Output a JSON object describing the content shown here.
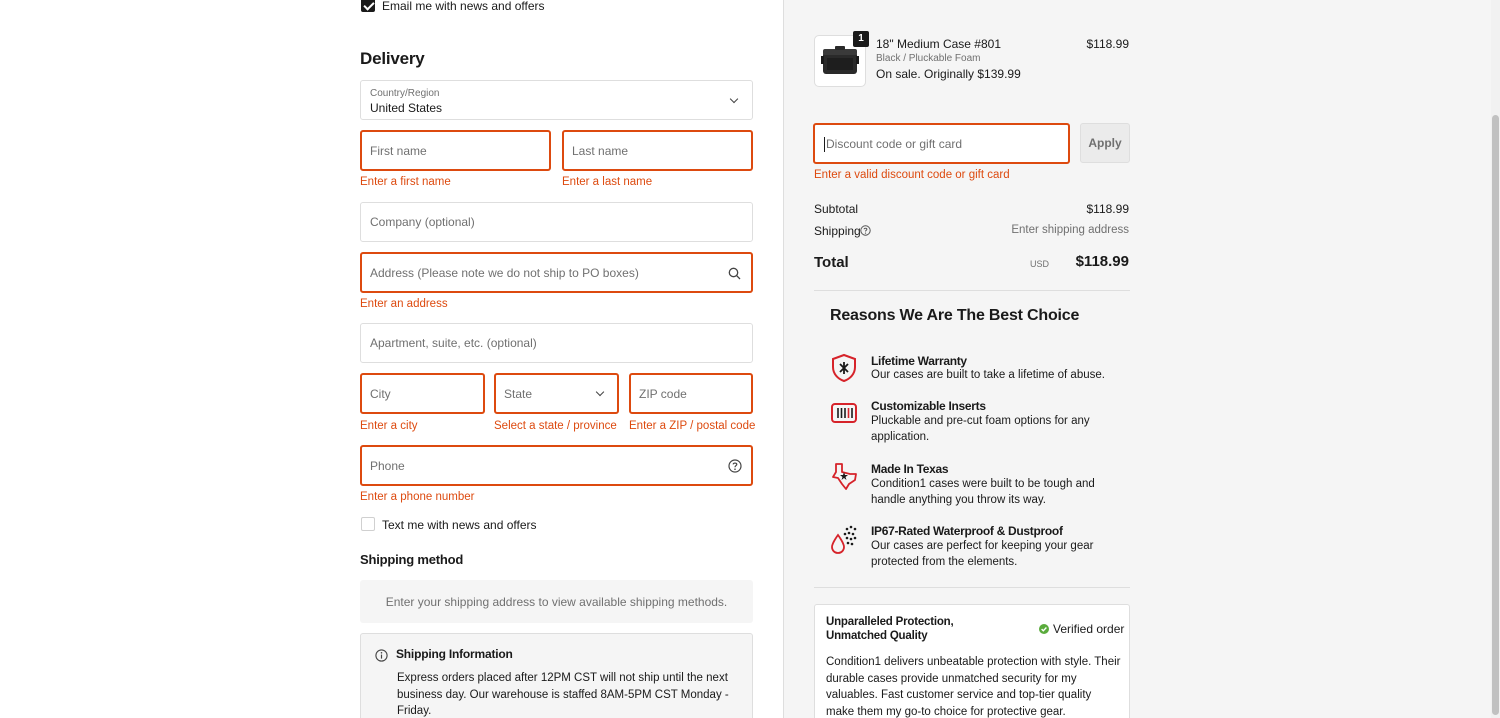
{
  "contact": {
    "email_opt_in_label": "Email me with news and offers",
    "email_opt_in_checked": true
  },
  "delivery": {
    "heading": "Delivery",
    "country": {
      "label": "Country/Region",
      "value": "United States"
    },
    "first_name": {
      "placeholder": "First name",
      "error": "Enter a first name"
    },
    "last_name": {
      "placeholder": "Last name",
      "error": "Enter a last name"
    },
    "company": {
      "placeholder": "Company (optional)"
    },
    "address": {
      "placeholder": "Address (Please note we do not ship to PO boxes)",
      "error": "Enter an address"
    },
    "apartment": {
      "placeholder": "Apartment, suite, etc. (optional)"
    },
    "city": {
      "placeholder": "City",
      "error": "Enter a city"
    },
    "state": {
      "placeholder": "State",
      "error": "Select a state / province"
    },
    "zip": {
      "placeholder": "ZIP code",
      "error": "Enter a ZIP / postal code"
    },
    "phone": {
      "placeholder": "Phone",
      "error": "Enter a phone number"
    },
    "sms_opt_in_label": "Text me with news and offers",
    "sms_opt_in_checked": false
  },
  "shipping_method": {
    "heading": "Shipping method",
    "empty_text": "Enter your shipping address to view available shipping methods."
  },
  "shipping_info": {
    "title": "Shipping Information",
    "lines": [
      "Express orders placed after 12PM CST will not ship until the next",
      "business day. Our warehouse is staffed 8AM-5PM CST Monday -",
      "Friday."
    ]
  },
  "order": {
    "item": {
      "quantity": "1",
      "name": "18\" Medium Case #801",
      "variant": "Black / Pluckable Foam",
      "sale_note": "On sale. Originally $139.99",
      "price": "$118.99"
    },
    "discount": {
      "placeholder": "Discount code or gift card",
      "apply_label": "Apply",
      "error": "Enter a valid discount code or gift card"
    },
    "subtotal_label": "Subtotal",
    "subtotal_value": "$118.99",
    "shipping_label": "Shipping",
    "shipping_value": "Enter shipping address",
    "total_label": "Total",
    "total_currency": "USD",
    "total_value": "$118.99"
  },
  "reasons": {
    "heading": "Reasons We Are The Best Choice",
    "items": [
      {
        "icon": "shield-icon",
        "title": "Lifetime Warranty",
        "desc": "Our cases are built to take a lifetime of abuse."
      },
      {
        "icon": "foam-insert-icon",
        "title": "Customizable Inserts",
        "desc": "Pluckable and pre-cut foam options for any application."
      },
      {
        "icon": "texas-icon",
        "title": "Made In Texas",
        "desc": "Condition1 cases were built to be tough and handle anything you throw its way."
      },
      {
        "icon": "waterproof-icon",
        "title": "IP67-Rated Waterproof & Dustproof",
        "desc": "Our cases are perfect for keeping your gear protected from the elements."
      }
    ]
  },
  "review": {
    "title": "Unparalleled Protection, Unmatched Quality",
    "verified_label": "Verified order",
    "body": "Condition1 delivers unbeatable protection with style. Their durable cases provide unmatched security for my valuables. Fast customer service and top-tier quality make them my go-to choice for protective gear."
  },
  "colors": {
    "error": "#dd4a0f",
    "accent_red": "#d6232a",
    "verified_green": "#5aab3c",
    "summary_bg": "#f5f5f5"
  }
}
